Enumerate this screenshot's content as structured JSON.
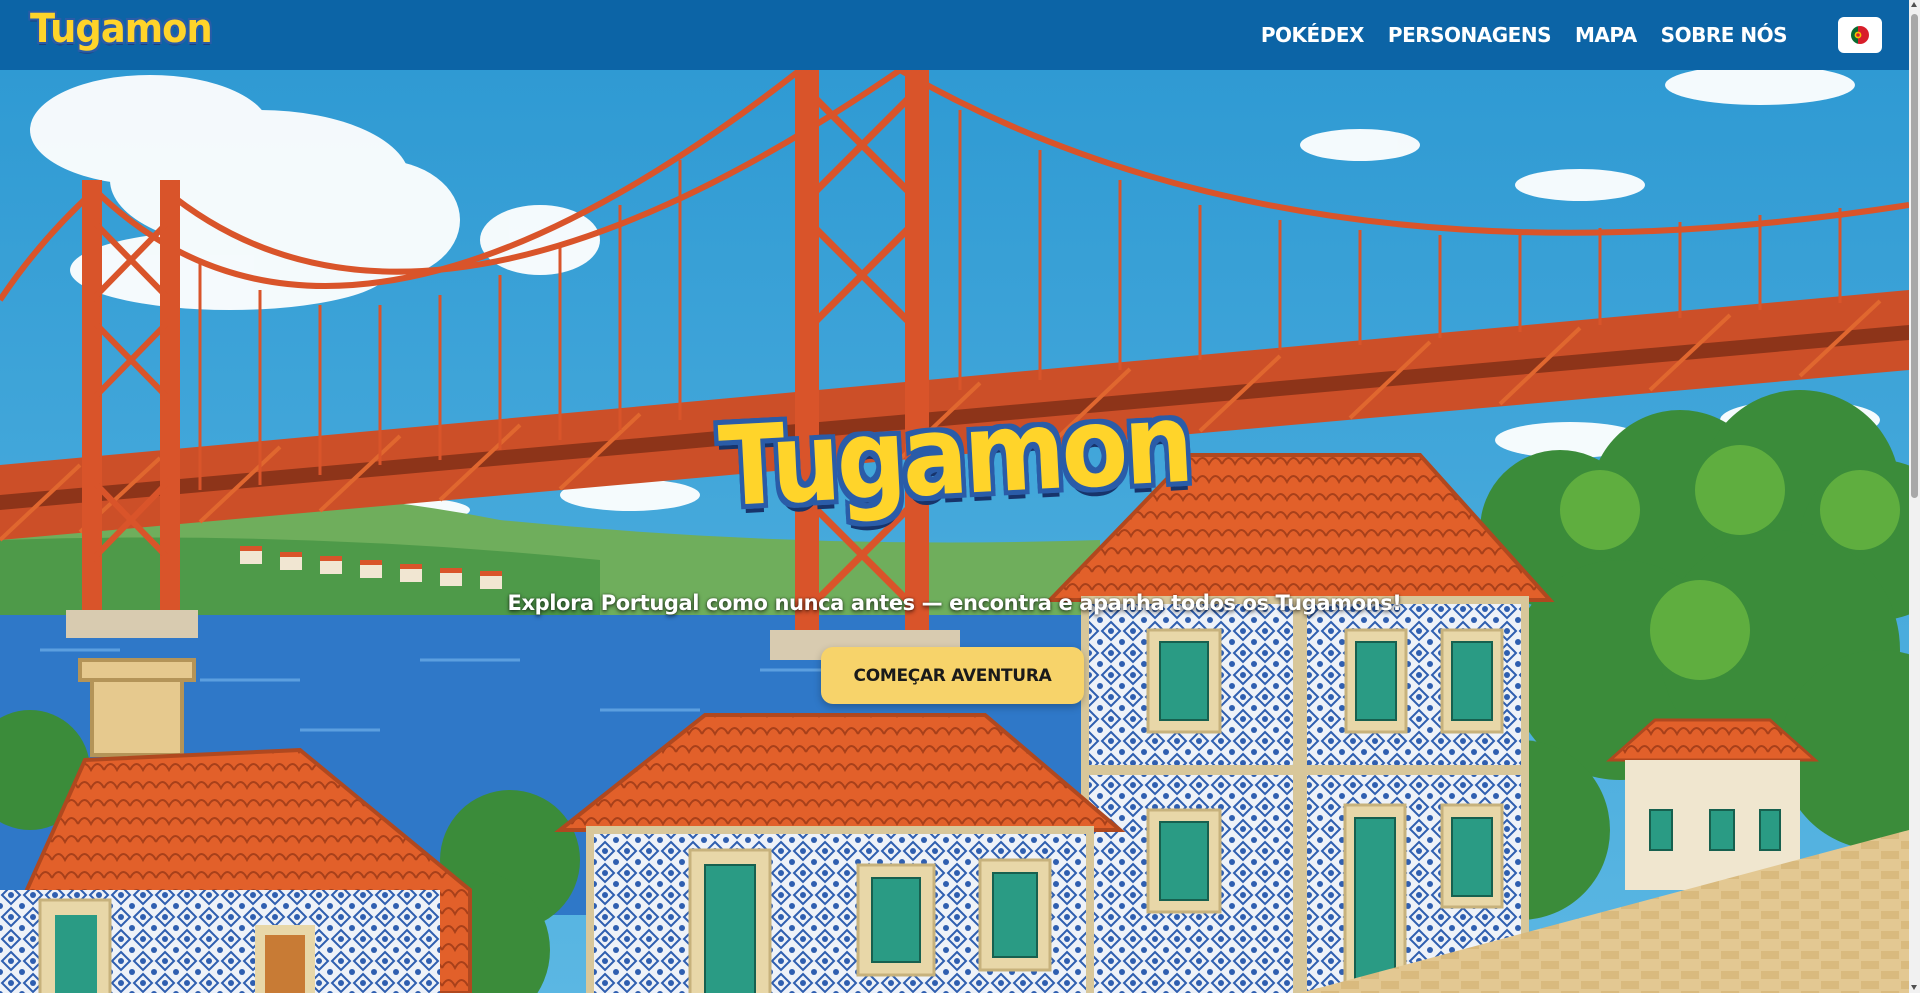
{
  "header": {
    "logo_text": "Tugamon",
    "nav": [
      {
        "label": "POKÉDEX"
      },
      {
        "label": "PERSONAGENS"
      },
      {
        "label": "MAPA"
      },
      {
        "label": "SOBRE NÓS"
      }
    ],
    "language_icon": "portugal-flag-icon"
  },
  "hero": {
    "logo_text": "Tugamon",
    "tagline": "Explora Portugal como nunca antes — encontra e apanha todos os Tugamons!",
    "cta_label": "COMEÇAR AVENTURA",
    "background": "illustrated-lisbon-bridge-and-tiled-houses"
  },
  "colors": {
    "header_bg": "#0c64a6",
    "logo_yellow": "#ffd42a",
    "logo_outline": "#2a5ca8",
    "cta_bg": "#f7d36a",
    "sky": "#3aa3d6",
    "bridge": "#d9542a",
    "roof": "#e2602a",
    "azulejo_blue": "#2f5fb0"
  }
}
